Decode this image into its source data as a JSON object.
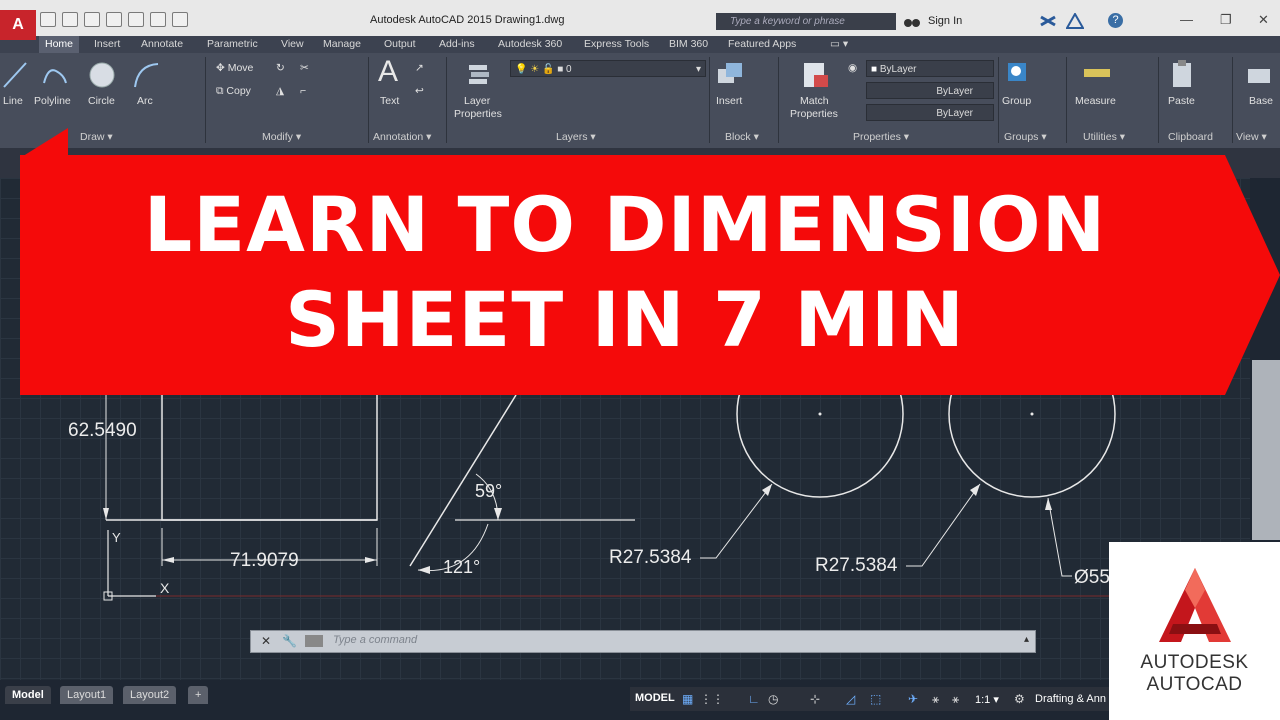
{
  "title_bar": {
    "app_logo": "A",
    "window_title": "Autodesk AutoCAD 2015    Drawing1.dwg",
    "search_placeholder": "Type a keyword or phrase",
    "sign_in": "Sign In",
    "help": "?"
  },
  "ribbon_tabs": [
    "Home",
    "Insert",
    "Annotate",
    "Parametric",
    "View",
    "Manage",
    "Output",
    "Add-ins",
    "Autodesk 360",
    "Express Tools",
    "BIM 360",
    "Featured Apps"
  ],
  "ribbon": {
    "draw": {
      "line": "Line",
      "polyline": "Polyline",
      "circle": "Circle",
      "arc": "Arc",
      "title": "Draw ▾"
    },
    "modify": {
      "move": "Move",
      "copy": "Copy",
      "title": "Modify ▾"
    },
    "annotation": {
      "text": "Text",
      "title": "Annotation ▾"
    },
    "layers": {
      "layer_properties_1": "Layer",
      "layer_properties_2": "Properties",
      "layer_value": "0",
      "title": "Layers ▾"
    },
    "block": {
      "insert": "Insert",
      "title": "Block ▾"
    },
    "properties": {
      "match_1": "Match",
      "match_2": "Properties",
      "color": "ByLayer",
      "linetype": "ByLayer",
      "lineweight": "ByLayer",
      "title": "Properties ▾"
    },
    "groups": {
      "group": "Group",
      "title": "Groups ▾"
    },
    "utilities": {
      "measure": "Measure",
      "title": "Utilities ▾"
    },
    "clipboard": {
      "paste": "Paste",
      "title": "Clipboard"
    },
    "view": {
      "base": "Base",
      "title": "View ▾"
    }
  },
  "banner": {
    "line1": "LEARN TO DIMENSION",
    "line2": "SHEET IN 7 MIN",
    "color": "#f50a0a"
  },
  "drawing": {
    "dim_vertical": "62.5490",
    "dim_horizontal": "71.9079",
    "angle_1": "59°",
    "angle_2": "121°",
    "radius_1": "R27.5384",
    "radius_2": "R27.5384",
    "diameter": "Ø55",
    "ucs_y": "Y",
    "ucs_x": "X"
  },
  "command_line": {
    "placeholder": "Type  a  command"
  },
  "layout_tabs": [
    "Model",
    "Layout1",
    "Layout2",
    "+"
  ],
  "status_bar": {
    "model": "MODEL",
    "scale": "1:1 ▾",
    "workspace": "Drafting & Ann"
  },
  "logo": {
    "word1": "AUTODESK",
    "word2": "AUTOCAD"
  }
}
